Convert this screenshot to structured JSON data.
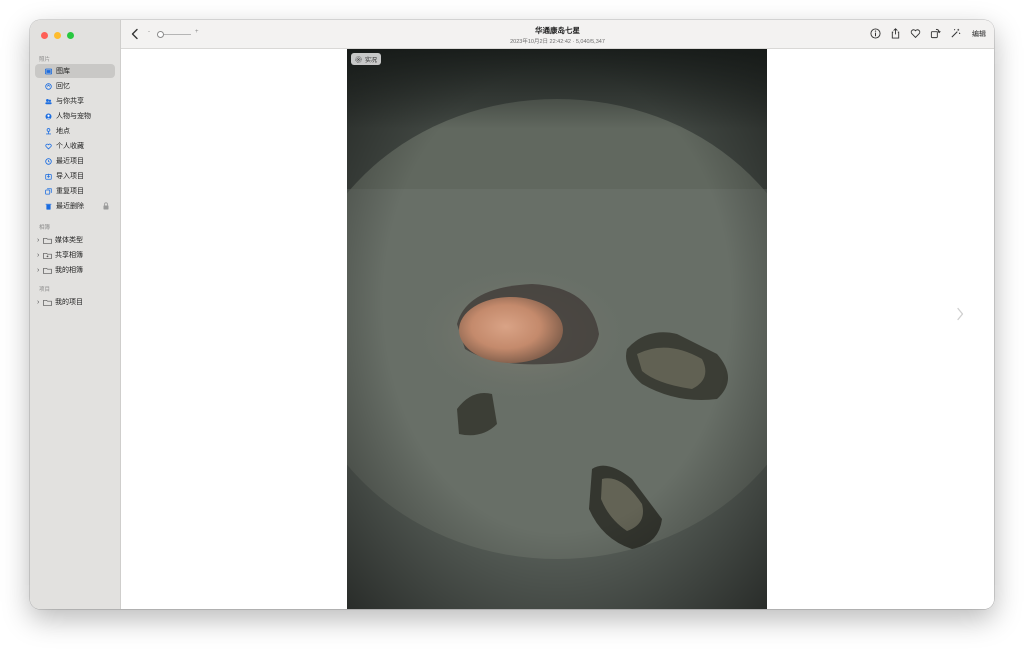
{
  "window": {
    "title": "华通康岛七星",
    "subtitle": "2023年10月2日 22:42:42 · 5,040/5,347"
  },
  "sidebar": {
    "section_photos": "照片",
    "items": [
      {
        "label": "图库",
        "icon": "photo-library-icon",
        "active": true
      },
      {
        "label": "回忆",
        "icon": "memories-icon"
      },
      {
        "label": "与你共享",
        "icon": "shared-with-you-icon"
      },
      {
        "label": "人物与宠物",
        "icon": "people-icon"
      },
      {
        "label": "地点",
        "icon": "places-icon"
      },
      {
        "label": "个人收藏",
        "icon": "heart-icon"
      },
      {
        "label": "最近项目",
        "icon": "clock-icon"
      },
      {
        "label": "导入项目",
        "icon": "import-icon"
      },
      {
        "label": "重复项目",
        "icon": "duplicates-icon"
      },
      {
        "label": "最近删除",
        "icon": "trash-icon",
        "locked": true
      }
    ],
    "section_albums": "相簿",
    "albums": [
      {
        "label": "媒体类型"
      },
      {
        "label": "共享相簿"
      },
      {
        "label": "我的相簿"
      }
    ],
    "section_projects": "项目",
    "projects": [
      {
        "label": "我的项目"
      }
    ]
  },
  "toolbar": {
    "edit_label": "编辑",
    "zoom_minus": "-",
    "zoom_plus": "+"
  },
  "photo": {
    "live_label": "实况"
  },
  "colors": {
    "accent": "#1a6ce0",
    "sidebar_bg": "#e2e1df",
    "toolbar_bg": "#f3f2f1"
  }
}
